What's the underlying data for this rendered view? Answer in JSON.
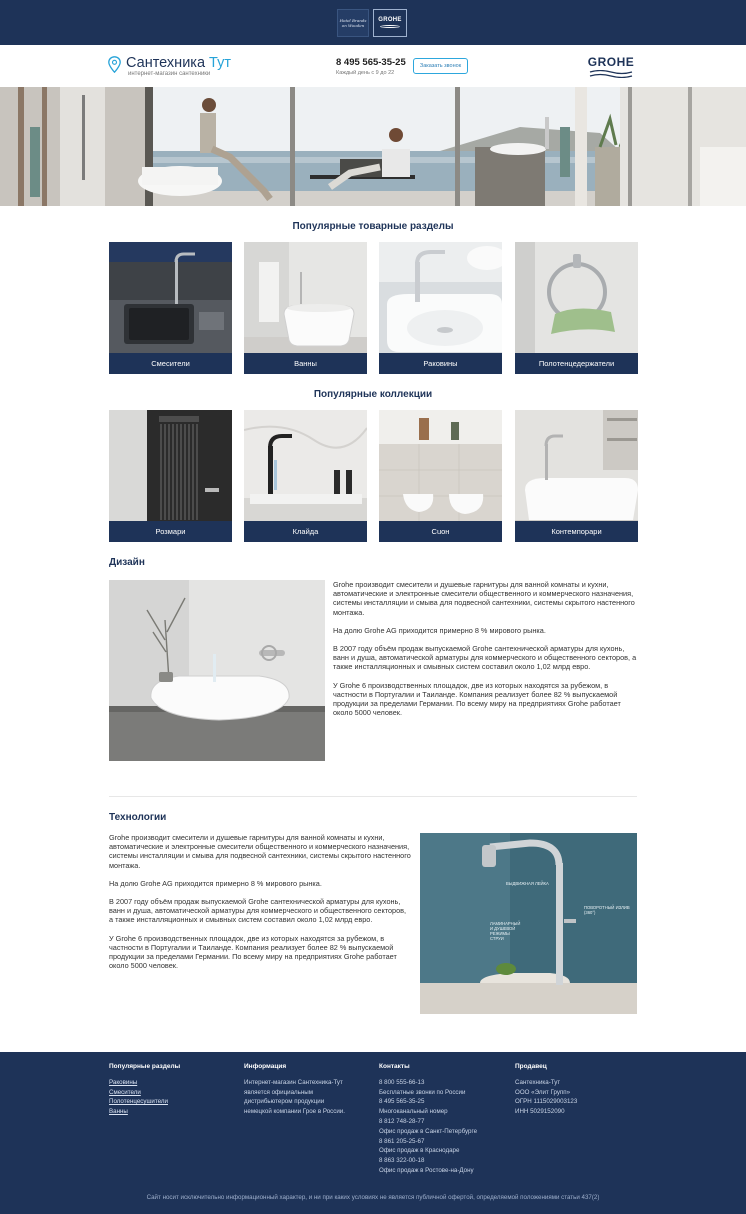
{
  "topbar": {
    "logo1_text": "Hotel Brands on Wooden",
    "logo2_text": "GROHE"
  },
  "header": {
    "logo_main": "Сантехника ",
    "logo_accent": "Тут",
    "logo_sub": "интернет-магазин сантехники",
    "phone": "8 495 565-35-25",
    "hours": "Каждый день с 9 до 22",
    "callback": "Заказать звонок",
    "brand": "GROHE"
  },
  "sections": {
    "popular_title": "Популярные товарные разделы",
    "popular": [
      {
        "label": "Смесители"
      },
      {
        "label": "Ванны"
      },
      {
        "label": "Раковины"
      },
      {
        "label": "Полотенцедержатели"
      }
    ],
    "collections_title": "Популярные коллекции",
    "collections": [
      {
        "label": "Розмари"
      },
      {
        "label": "Клайда"
      },
      {
        "label": "Сuон"
      },
      {
        "label": "Контемпорари"
      }
    ]
  },
  "design": {
    "title": "Дизайн",
    "p1": "Grohe производит смесители и душевые гарнитуры для ванной комнаты и кухни, автоматические и электронные смесители общественного и коммерческого назначения, системы инсталляции и смыва для подвесной сантехники, системы скрытого настенного монтажа.",
    "p2": "На долю Grohe AG приходится примерно 8 % мирового рынка.",
    "p3": "В 2007 году объём продаж выпускаемой Grohe сантехнической арматуры для кухонь, ванн и душа, автоматической арматуры для коммерческого и общественного секторов, а также инсталляционных и смывных систем составил около 1,02 млрд евро.",
    "p4": "У Grohe 6 производственных площадок, две из которых находятся за рубежом, в частности в Португалии и Таиланде. Компания реализует более 82 % выпускаемой продукции за пределами Германии. По всему миру на предприятиях Grohe работает около 5000 человек."
  },
  "tech": {
    "title": "Технологии",
    "p1": "Grohe производит смесители и душевые гарнитуры для ванной комнаты и кухни, автоматические и электронные смесители общественного и коммерческого назначения, системы инсталляции и смыва для подвесной сантехники, системы скрытого настенного монтажа.",
    "p2": "На долю Grohe AG приходится примерно 8 % мирового рынка.",
    "p3": "В 2007 году объём продаж выпускаемой Grohe сантехнической арматуры для кухонь, ванн и душа, автоматической арматуры для коммерческого и общественного секторов, а также инсталляционных и смывных систем составил около 1,02 млрд евро.",
    "p4": "У Grohe 6 производственных площадок, две из которых находятся за рубежом, в частности в Португалии и Таиланде. Компания реализует более 82 % выпускаемой продукции за пределами Германии. По всему миру на предприятиях Grohe работает около 5000 человек.",
    "img_label1": "ВЫДВИЖНАЯ ЛЕЙКА",
    "img_label2": "ПОВОРОТНЫЙ ИЗЛИВ (360°)",
    "img_label3": "ЛАМИНАРНЫЙ И ДУШЕВОЙ РЕЖИМЫ СТРУИ"
  },
  "footer": {
    "col1_title": "Популярные разделы",
    "col1_links": [
      "Раковины",
      "Смесители",
      "Полотенцесушители",
      "Ванны"
    ],
    "col2_title": "Информация",
    "col2_lines": [
      "Интернет-магазин Сантехника-Тут",
      "является официальным",
      "дистрибьютером продукции",
      "немецкой компании Грое в России."
    ],
    "col3_title": "Контакты",
    "col3_lines": [
      "8 800 555-66-13",
      "Бесплатные звонки по России",
      "8 495 565-35-25",
      "Многоканальный номер",
      "8 812 748-28-77",
      "Офис продаж в Санкт-Петербурге",
      "8 861 205-25-67",
      "Офис продаж в Краснодаре",
      "8 863 322-00-18",
      "Офис продаж в Ростове-на-Дону"
    ],
    "col4_title": "Продавец",
    "col4_lines": [
      "Сантехника-Тут",
      "ООО «Элит Групп»",
      "ОГРН 1115029003123",
      "ИНН 5029152090"
    ],
    "copyright": "Сайт носит исключительно информационный характер, и ни при каких условиях не является публичной офертой, определяемой положениями статьи 437(2)"
  }
}
